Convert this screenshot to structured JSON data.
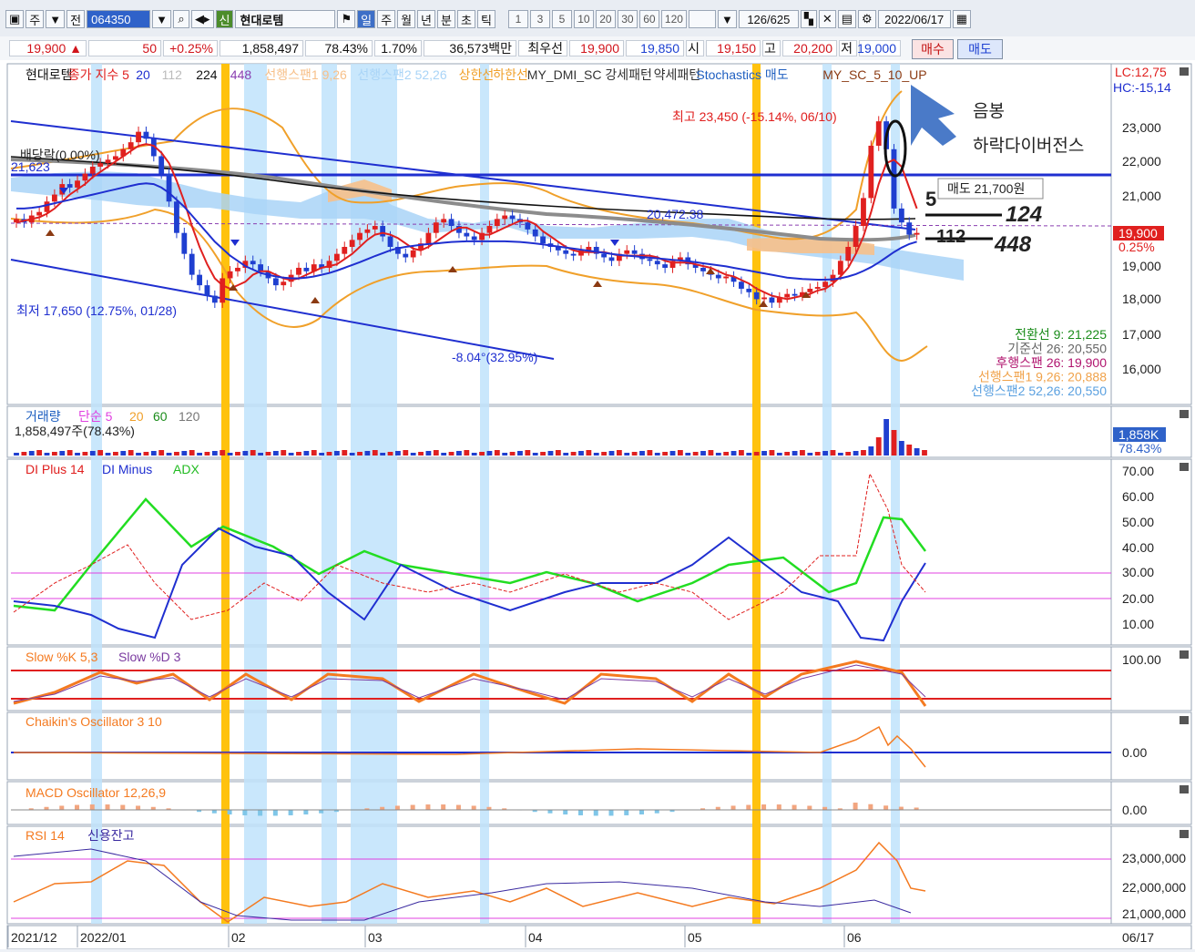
{
  "toolbar": {
    "market_select": "주",
    "period_label": "전",
    "stock_code": "064350",
    "credit_badge": "신",
    "stock_name": "현대로템",
    "period_buttons": [
      "일",
      "주",
      "월",
      "년",
      "분",
      "초",
      "틱"
    ],
    "active_period": "일",
    "interval_buttons": [
      "1",
      "3",
      "5",
      "10",
      "20",
      "30",
      "60",
      "120"
    ],
    "page_counter": "126/625",
    "date": "2022/06/17"
  },
  "quote": {
    "price": "19,900 ▲",
    "change": "50",
    "change_pct": "+0.25%",
    "volume": "1,858,497",
    "volume_ratio": "78.43%",
    "turnover": "1.70%",
    "amount": "36,573백만",
    "best_label": "최우선",
    "best_ask": "19,900",
    "best_bid": "19,850",
    "open_label": "시",
    "open": "19,150",
    "high_label": "고",
    "high": "20,200",
    "low_label": "저",
    "low": "19,000",
    "buy_button": "매수",
    "sell_button": "매도"
  },
  "legend": {
    "price": {
      "name": "현대로템",
      "ma": "종가 지수 5",
      "ma_periods": [
        "20",
        "112",
        "224",
        "448"
      ],
      "span1": "선행스팬1 9,26",
      "span2": "선행스팬2 52,26",
      "upper": "상한선",
      "lower": "하한선",
      "dmi": "MY_DMI_SC 강세패턴",
      "weak": "약세패턴",
      "stoch": "Stochastics 매도",
      "mysc": "MY_SC_5_10_UP",
      "lc": "LC:12,75",
      "hc": "HC:-15,14"
    },
    "volume": {
      "name": "거래량",
      "ma": "단순 5",
      "p20": "20",
      "p60": "60",
      "p120": "120",
      "value": "1,858,497주(78.43%)"
    },
    "dmi": {
      "plus": "DI Plus 14",
      "minus": "DI Minus",
      "adx": "ADX"
    },
    "slow": {
      "k": "Slow %K 5,3",
      "d": "Slow %D 3"
    },
    "chaikin": "Chaikin's Oscillator 3 10",
    "macd": "MACD Oscillator 12,26,9",
    "rsi": {
      "name": "RSI 14",
      "credit": "신용잔고"
    }
  },
  "annotations": {
    "dividend": "배당락(0.00%)",
    "level_left": "21,623",
    "high": "최고 23,450 (-15.14%, 06/10)",
    "low": "최저 17,650 (12.75%, 01/28)",
    "channel": "-8.04°(32.95%)",
    "cloud_label": "20,472.38",
    "callout_1": "음봉",
    "callout_2": "하락다이버전스",
    "sell_box": "매도 21,700원",
    "hand_5": "5",
    "hand_124": "124",
    "hand_112": "112",
    "hand_448": "448",
    "ichimoku": [
      {
        "text": "전환선 9: 21,225",
        "color": "#1a8c1a"
      },
      {
        "text": "기준선 26: 20,550",
        "color": "#666666"
      },
      {
        "text": "후행스팬 26: 19,900",
        "color": "#b0146e"
      },
      {
        "text": "선행스팬1 9,26: 20,888",
        "color": "#f0a24a"
      },
      {
        "text": "선행스팬2 52,26: 20,550",
        "color": "#5aa0e0"
      }
    ],
    "last_price": "19,900",
    "last_pct": "0.25%",
    "vol_last": "1,858K",
    "vol_pct": "78.43%"
  },
  "axes": {
    "price_ticks": [
      "23,000",
      "22,000",
      "21,000",
      "19,000",
      "18,000",
      "17,000",
      "16,000"
    ],
    "dmi_ticks": [
      "70.00",
      "60.00",
      "50.00",
      "40.00",
      "30.00",
      "20.00",
      "10.00"
    ],
    "slow_tick": "100.00",
    "chaikin_tick": "0.00",
    "macd_tick": "0.00",
    "rsi_ticks": [
      "23,000,000",
      "22,000,000",
      "21,000,000"
    ],
    "dates": [
      "2021/12",
      "2022/01",
      "02",
      "03",
      "04",
      "05",
      "06"
    ],
    "end_date": "06/17"
  },
  "colors": {
    "up": "#e0201f",
    "down": "#1f3fd0",
    "accent": "#3d6fc7",
    "highlight": "#ffc20e",
    "band": "#bfe3fb"
  },
  "chart_data": {
    "type": "candlestick",
    "title": "현대로템 일봉",
    "xlabel": "",
    "ylabel": "",
    "ylim": [
      15600,
      23700
    ],
    "x": [
      "12/21",
      "12/22",
      "12/23",
      "12/24",
      "12/27",
      "12/28",
      "12/29",
      "12/30",
      "01/03",
      "01/04",
      "01/05",
      "01/06",
      "01/07",
      "01/10",
      "01/11",
      "01/12",
      "01/13",
      "01/14",
      "01/17",
      "01/18",
      "01/19",
      "01/20",
      "01/21",
      "01/24",
      "01/25",
      "01/26",
      "01/27",
      "01/28",
      "02/03",
      "02/04",
      "02/07",
      "02/08",
      "02/09",
      "02/10",
      "02/11",
      "02/14",
      "02/15",
      "02/16",
      "02/17",
      "02/18",
      "02/21",
      "02/22",
      "02/23",
      "02/24",
      "02/25",
      "02/28",
      "03/02",
      "03/03",
      "03/04",
      "03/07",
      "03/08",
      "03/10",
      "03/11",
      "03/14",
      "03/15",
      "03/16",
      "03/17",
      "03/18",
      "03/21",
      "03/22",
      "03/23",
      "03/24",
      "03/25",
      "03/28",
      "03/29",
      "03/30",
      "03/31",
      "04/01",
      "04/04",
      "04/05",
      "04/06",
      "04/07",
      "04/08",
      "04/11",
      "04/12",
      "04/13",
      "04/14",
      "04/15",
      "04/18",
      "04/19",
      "04/20",
      "04/21",
      "04/22",
      "04/25",
      "04/26",
      "04/27",
      "04/28",
      "04/29",
      "05/02",
      "05/03",
      "05/04",
      "05/06",
      "05/09",
      "05/10",
      "05/11",
      "05/12",
      "05/13",
      "05/16",
      "05/17",
      "05/18",
      "05/19",
      "05/20",
      "05/23",
      "05/24",
      "05/25",
      "05/26",
      "05/27",
      "05/30",
      "05/31",
      "06/02",
      "06/03",
      "06/07",
      "06/08",
      "06/09",
      "06/10",
      "06/13",
      "06/14",
      "06/15",
      "06/16",
      "06/17"
    ],
    "close": [
      20300,
      20200,
      20400,
      20500,
      20800,
      21000,
      21300,
      21200,
      21400,
      21600,
      21800,
      21900,
      22000,
      22100,
      22300,
      22500,
      22800,
      22600,
      22100,
      21600,
      20800,
      19900,
      19300,
      18700,
      18400,
      18100,
      17900,
      18600,
      18800,
      18900,
      19100,
      19000,
      18800,
      18600,
      18400,
      18500,
      18700,
      18900,
      18800,
      19000,
      18900,
      19100,
      19300,
      19500,
      19700,
      19900,
      20000,
      20100,
      19800,
      19500,
      19300,
      19200,
      19400,
      19600,
      19900,
      20200,
      20300,
      20100,
      19900,
      19800,
      19700,
      19900,
      20100,
      20300,
      20400,
      20300,
      20200,
      20000,
      19800,
      19600,
      19500,
      19400,
      19300,
      19250,
      19400,
      19500,
      19300,
      19200,
      19100,
      19300,
      19400,
      19300,
      19150,
      19100,
      19000,
      18900,
      19100,
      19200,
      19000,
      18900,
      18800,
      18700,
      18600,
      18650,
      18500,
      18300,
      18200,
      18000,
      18050,
      17900,
      18050,
      18150,
      18100,
      18200,
      18300,
      18350,
      18500,
      18700,
      19100,
      19500,
      20100,
      20900,
      22400,
      23100,
      22300,
      20600,
      20200,
      19850,
      19900
    ],
    "ma5": [
      20200,
      20250,
      20300,
      20350,
      20450,
      20600,
      20800,
      21000,
      21150,
      21300,
      21500,
      21650,
      21800,
      21950,
      22100,
      22250,
      22400,
      22450,
      22400,
      22200,
      21900,
      21400,
      20800,
      20100,
      19500,
      19000,
      18600,
      18400,
      18300,
      18400,
      18500,
      18700,
      18800,
      18800,
      18700,
      18600,
      18550,
      18600,
      18700,
      18800,
      18900,
      18950,
      19000,
      19150,
      19300,
      19500,
      19700,
      19850,
      19900,
      19850,
      19750,
      19600,
      19450,
      19400,
      19500,
      19650,
      19800,
      19950,
      20050,
      20050,
      19950,
      19850,
      19850,
      19950,
      20050,
      20150,
      20250,
      20250,
      20150,
      19950,
      19800,
      19650,
      19500,
      19400,
      19350,
      19350,
      19350,
      19350,
      19300,
      19250,
      19250,
      19250,
      19250,
      19250,
      19200,
      19100,
      19050,
      19050,
      19050,
      19000,
      18950,
      18900,
      18800,
      18700,
      18650,
      18550,
      18450,
      18300,
      18200,
      18100,
      18050,
      18000,
      18050,
      18100,
      18150,
      18250,
      18300,
      18450,
      18650,
      18900,
      19300,
      19800,
      20500,
      21300,
      21900,
      22000,
      21800,
      21200,
      20600
    ],
    "ma20": [
      20600,
      20600,
      20620,
      20650,
      20700,
      20750,
      20800,
      20850,
      20900,
      20950,
      21000,
      21050,
      21100,
      21150,
      21200,
      21250,
      21300,
      21320,
      21300,
      21200,
      21050,
      20850,
      20650,
      20400,
      20150,
      19900,
      19650,
      19450,
      19250,
      19100,
      18950,
      18850,
      18750,
      18700,
      18650,
      18620,
      18600,
      18600,
      18620,
      18650,
      18700,
      18750,
      18820,
      18900,
      18980,
      19060,
      19150,
      19240,
      19320,
      19400,
      19460,
      19500,
      19530,
      19560,
      19580,
      19600,
      19620,
      19640,
      19650,
      19660,
      19660,
      19660,
      19660,
      19660,
      19660,
      19650,
      19640,
      19620,
      19600,
      19570,
      19540,
      19510,
      19480,
      19450,
      19420,
      19390,
      19360,
      19330,
      19300,
      19270,
      19250,
      19230,
      19210,
      19190,
      19170,
      19150,
      19130,
      19110,
      19090,
      19060,
      19030,
      19000,
      18970,
      18940,
      18900,
      18860,
      18820,
      18780,
      18740,
      18700,
      18660,
      18620,
      18600,
      18580,
      18570,
      18560,
      18560,
      18570,
      18600,
      18650,
      18720,
      18810,
      18920,
      19050,
      19200,
      19350,
      19480,
      19580,
      19650
    ]
  }
}
